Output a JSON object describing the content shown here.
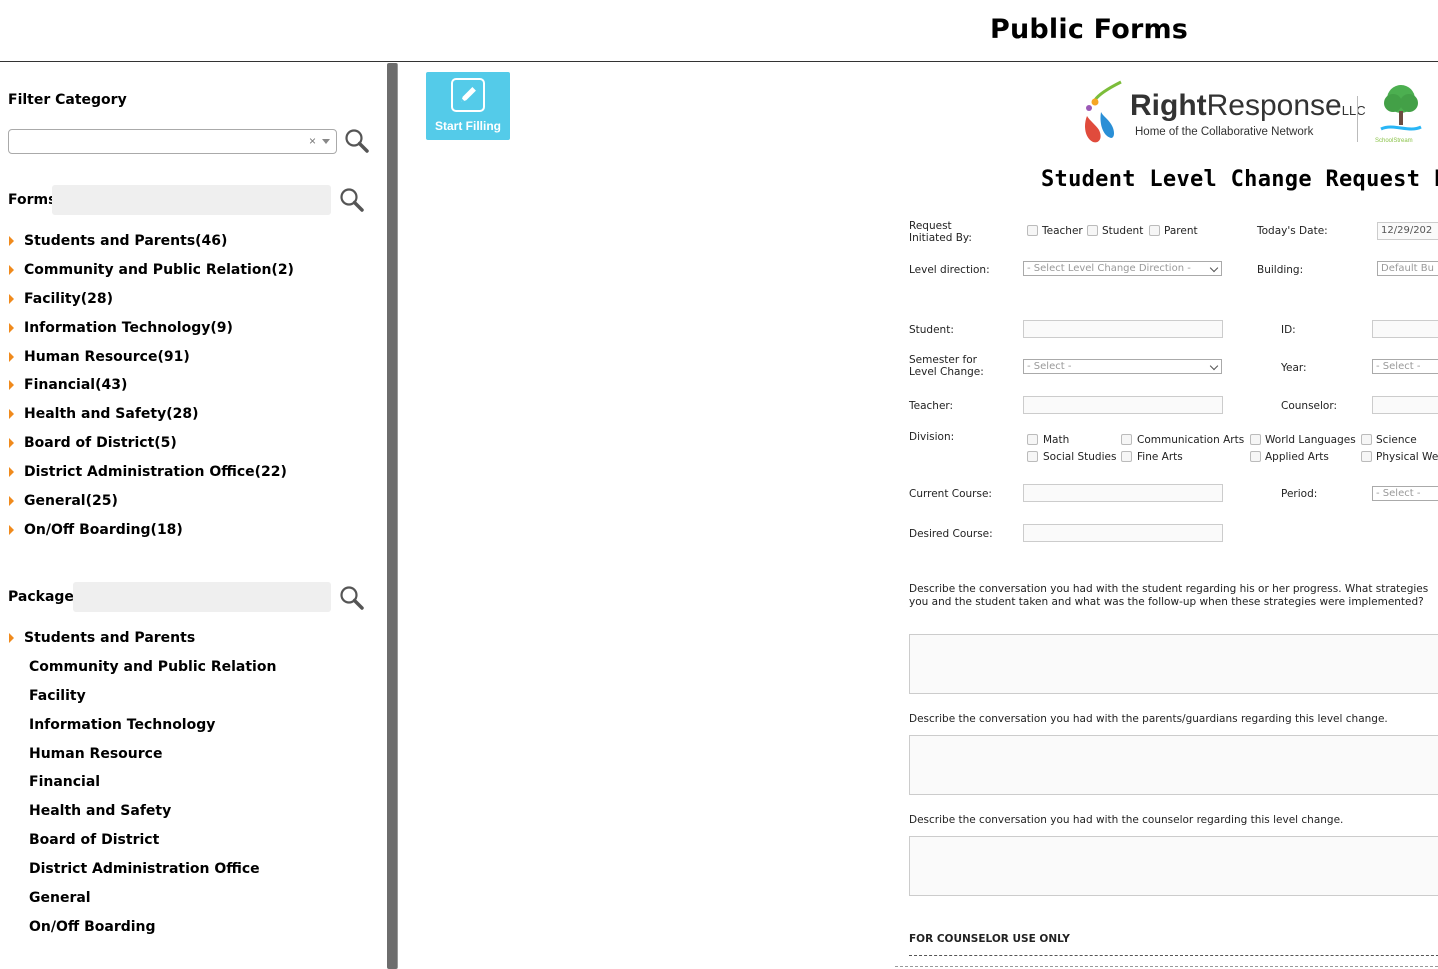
{
  "header": {
    "title": "Public Forms"
  },
  "sidebar": {
    "filter_label": "Filter Category",
    "filter_clear": "×",
    "forms_label": "Forms",
    "packages_label": "Packages",
    "forms": [
      "Students and Parents(46)",
      "Community and Public Relation(2)",
      "Facility(28)",
      "Information Technology(9)",
      "Human Resource(91)",
      "Financial(43)",
      "Health and Safety(28)",
      "Board of District(5)",
      "District Administration Office(22)",
      "General(25)",
      "On/Off Boarding(18)"
    ],
    "packages": [
      "Students and Parents",
      "Community and Public Relation",
      "Facility",
      "Information Technology",
      "Human Resource",
      "Financial",
      "Health and Safety",
      "Board of District",
      "District Administration Office",
      "General",
      "On/Off Boarding"
    ]
  },
  "toolbar": {
    "start_label": "Start Filling"
  },
  "form": {
    "logo_right": "Right",
    "logo_response": "Response",
    "logo_llc": "LLC",
    "logo_sub": "Home of the Collaborative Network",
    "logo_ss": "SchoolStream",
    "title": "Student Level Change Request Fo",
    "initiated_label": "Request\nInitiated By:",
    "opt_teacher": "Teacher",
    "opt_student": "Student",
    "opt_parent": "Parent",
    "today_label": "Today's Date:",
    "today_value": "12/29/202",
    "level_dir_label": "Level direction:",
    "level_dir_value": "- Select Level Change Direction -",
    "building_label": "Building:",
    "building_value": "Default Bu",
    "student_label": "Student:",
    "id_label": "ID:",
    "semester_label": "Semester for\nLevel Change:",
    "semester_value": "- Select -",
    "year_label": "Year:",
    "year_value": "- Select -",
    "teacher_label": "Teacher:",
    "counselor_label": "Counselor:",
    "division_label": "Division:",
    "div_math": "Math",
    "div_comm": "Communication Arts",
    "div_world": "World Languages",
    "div_science": "Science",
    "div_social": "Social Studies",
    "div_fine": "Fine Arts",
    "div_applied": "Applied Arts",
    "div_physical": "Physical We",
    "current_course_label": "Current Course:",
    "period_label": "Period:",
    "period_value": "- Select -",
    "desired_course_label": "Desired Course:",
    "q1": "Describe the conversation you had with the student regarding his or her progress. What strategies\nyou and the student taken and what was the follow-up when these strategies were implemented?",
    "q2": "Describe the conversation you had with the parents/guardians regarding this level change.",
    "q3": "Describe the conversation you had with the counselor regarding this level change.",
    "counselor_only": "FOR COUNSELOR USE ONLY"
  }
}
